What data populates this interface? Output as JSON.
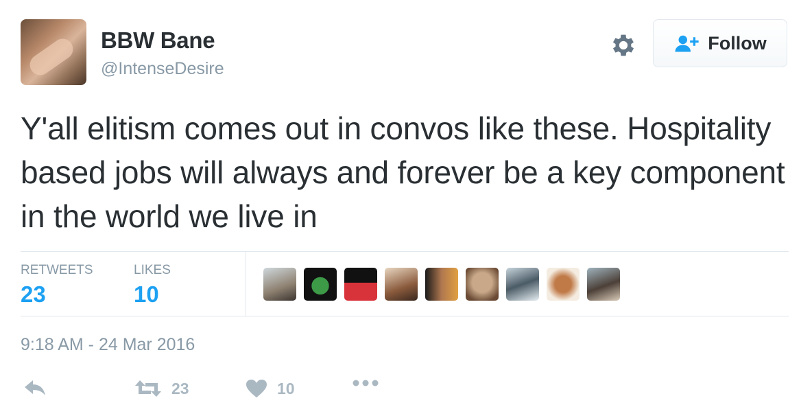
{
  "user": {
    "display_name": "BBW Bane",
    "handle": "@IntenseDesire"
  },
  "header": {
    "follow_label": "Follow"
  },
  "tweet": {
    "text": "Y'all elitism comes out in convos like these. Hospitality based jobs will always and forever be a key component in the world we live in",
    "timestamp": "9:18 AM - 24 Mar 2016"
  },
  "stats": {
    "retweets_label": "RETWEETS",
    "retweets_count": "23",
    "likes_label": "LIKES",
    "likes_count": "10"
  },
  "actions": {
    "retweet_count": "23",
    "like_count": "10"
  },
  "colors": {
    "accent": "#1da1f2",
    "muted": "#8899a6",
    "icon": "#aab8c2",
    "text": "#292f33"
  },
  "icons": [
    "gear-icon",
    "follow-person-icon",
    "reply-icon",
    "retweet-icon",
    "heart-icon",
    "more-icon"
  ]
}
